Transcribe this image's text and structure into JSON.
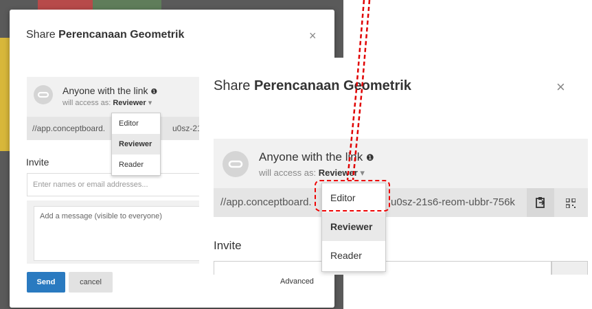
{
  "dialog": {
    "title_prefix": "Share",
    "title_board": "Perencanaan Geometrik",
    "close_glyph": "×",
    "link_title": "Anyone with the link",
    "info_glyph": "❶",
    "access_prefix": "will access as:",
    "access_value": "Reviewer",
    "access_caret": "▾",
    "url_small": "//app.conceptboard.",
    "url_small_tail": "u0sz-21s6",
    "url_zoom_a": "//app.conceptboard.",
    "url_zoom_b": "u0sz-21s6-reom-ubbr-756k",
    "invite_label": "Invite",
    "invite_placeholder": "Enter names or email addresses...",
    "message_placeholder": "Add a message (visible to everyone)",
    "send_label": "Send",
    "cancel_label": "cancel",
    "advanced_label": "Advanced"
  },
  "access_menu": {
    "options": [
      "Editor",
      "Reviewer",
      "Reader"
    ],
    "selected": "Reviewer"
  },
  "icons": {
    "copy": "clipboard-icon",
    "qr": "qr-code-icon",
    "link": "link-icon"
  },
  "colors": {
    "primary": "#2a7ac0",
    "annotation": "#e00000"
  }
}
